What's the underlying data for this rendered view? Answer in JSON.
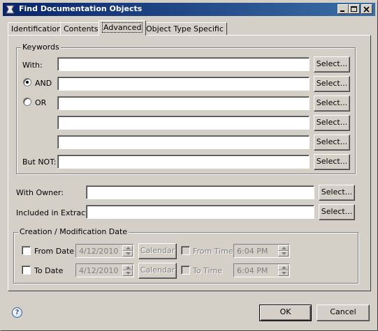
{
  "window": {
    "title": "Find Documentation Objects"
  },
  "tabs": [
    {
      "label": "Identification"
    },
    {
      "label": "Contents"
    },
    {
      "label": "Advanced"
    },
    {
      "label": "Object Type Specific"
    }
  ],
  "keywords": {
    "group_label": "Keywords",
    "with_label": "With:",
    "and_label": "AND",
    "or_label": "OR",
    "but_not_label": "But NOT:",
    "selected_operator": "AND",
    "fields": [
      "",
      "",
      "",
      "",
      "",
      ""
    ],
    "select_label": "Select..."
  },
  "owner": {
    "label": "With Owner:",
    "value": "",
    "select_label": "Select..."
  },
  "extract": {
    "label": "Included in Extract:",
    "value": "",
    "select_label": "Select..."
  },
  "dates": {
    "group_label": "Creation / Modification Date",
    "from_date": {
      "label": "From Date",
      "value": "4/12/2010",
      "checked": false
    },
    "to_date": {
      "label": "To Date",
      "value": "4/12/2010",
      "checked": false
    },
    "calendar_label": "Calendar",
    "from_time": {
      "label": "From Time",
      "value": "6:04 PM",
      "checked": false
    },
    "to_time": {
      "label": "To Time",
      "value": "6:04 PM",
      "checked": false
    }
  },
  "footer": {
    "help_icon": "question-icon",
    "ok_label": "OK",
    "cancel_label": "Cancel"
  },
  "colors": {
    "face": "#d4d0c8",
    "title_start": "#0a246a",
    "title_end": "#3a6ea5"
  }
}
